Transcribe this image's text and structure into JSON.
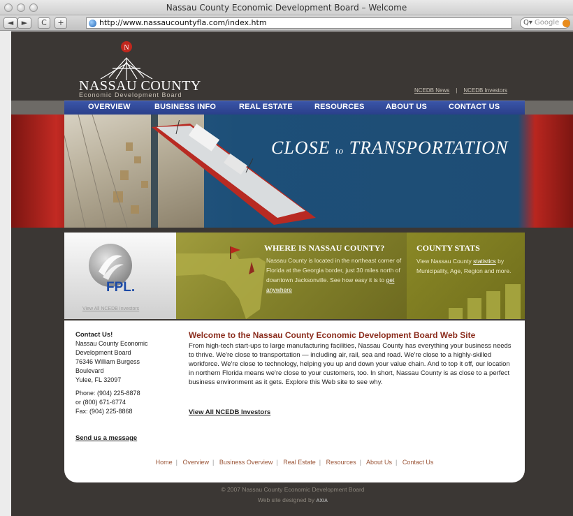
{
  "window": {
    "title": "Nassau County Economic Development Board – Welcome"
  },
  "toolbar": {
    "back_label": "◄",
    "forward_label": "►",
    "reload_label": "C",
    "add_label": "+",
    "url": "http://www.nassaucountyfla.com/index.htm",
    "search_placeholder": "Google",
    "search_glass": "Q▾"
  },
  "logo": {
    "name": "NASSAU COUNTY",
    "subtitle": "Economic Development Board",
    "compass_letter": "N"
  },
  "top_links": {
    "news": "NCEDB News",
    "separator": "|",
    "investors": "NCEDB Investors"
  },
  "nav": [
    {
      "label": "OVERVIEW"
    },
    {
      "label": "BUSINESS INFO"
    },
    {
      "label": "REAL ESTATE"
    },
    {
      "label": "RESOURCES"
    },
    {
      "label": "ABOUT US"
    },
    {
      "label": "CONTACT US"
    }
  ],
  "banner": {
    "tagline_1": "Close",
    "tagline_2": "to",
    "tagline_3": "Transportation"
  },
  "fpl": {
    "logo": "FPL.",
    "link": "View All NCEDB Investors"
  },
  "where": {
    "title": "WHERE IS NASSAU COUNTY?",
    "body": "Nassau County is located in the northeast corner of Florida at the Georgia border, just 30 miles north of downtown Jacksonville. See how easy it is to",
    "link": "get anywhere"
  },
  "stats": {
    "title": "COUNTY STATS",
    "body_pre": "View Nassau County",
    "link": "statistics",
    "body_post": "by Municipality, Age, Region and more."
  },
  "contact": {
    "heading": "Contact Us!",
    "org_1": "Nassau County Economic",
    "org_2": "Development Board",
    "street_1": "76346 William Burgess",
    "street_2": "Boulevard",
    "city": "Yulee, FL 32097",
    "phone": "Phone: (904) 225-8878",
    "alt_phone": "or (800) 671-6774",
    "fax": "Fax: (904) 225-8868",
    "send": "Send us a message"
  },
  "welcome": {
    "title": "Welcome to the Nassau County Economic Development Board Web Site",
    "body": "From high-tech start-ups to large manufacturing facilities, Nassau County has everything your business needs to thrive. We're close to transportation — including air, rail, sea and road. We're close to a highly-skilled workforce. We're close to technology, helping you up and down your value chain. And to top it off, our location in northern Florida means we're close to your customers, too. In short, Nassau County is as close to a perfect business environment as it gets. Explore this Web site to see why.",
    "investors_link": "View All NCEDB Investors"
  },
  "bottom_nav": [
    "Home",
    "Overview",
    "Business Overview",
    "Real Estate",
    "Resources",
    "About Us",
    "Contact Us"
  ],
  "bottom_nav_separator": "|",
  "footer": {
    "copyright": "© 2007 Nassau County Economic Development Board",
    "designed_by": "Web site designed by",
    "designer": "AXIA"
  },
  "colors": {
    "nav_blue": "#2f4897",
    "olive": "#85832b",
    "heading_red": "#8b2d1d",
    "page_bg": "#3b3734"
  }
}
